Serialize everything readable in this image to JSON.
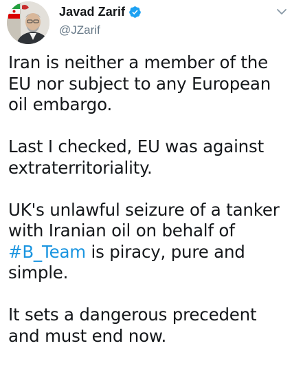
{
  "tweet": {
    "author": {
      "display_name": "Javad Zarif",
      "handle": "@JZarif",
      "verified_icon": "verified-badge-icon"
    },
    "menu_icon": "chevron-down-icon",
    "paragraphs": [
      {
        "text": "Iran is neither a member of the EU nor subject to any European oil embargo."
      },
      {
        "text": "Last I checked, EU was against extraterritoriality."
      },
      {
        "before": "UK's unlawful seizure of a tanker with Iranian oil on behalf of ",
        "hashtag": "#B_Team",
        "after": " is piracy, pure and simple."
      },
      {
        "text": "It sets a dangerous precedent and must end now."
      }
    ]
  },
  "colors": {
    "text": "#14171a",
    "secondary": "#657786",
    "link": "#1b95e0",
    "verified": "#1da1f2"
  }
}
